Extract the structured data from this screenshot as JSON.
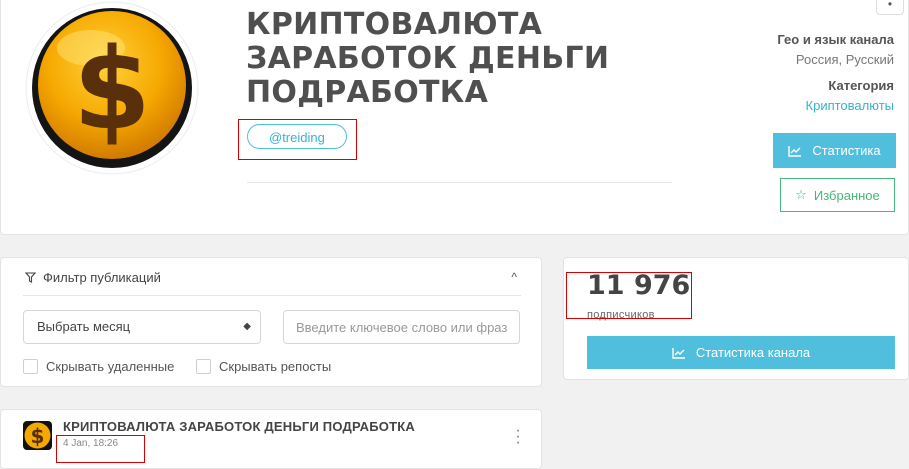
{
  "channel": {
    "title": "КРИПТОВАЛЮТА ЗАРАБОТОК ДЕНЬГИ ПОДРАБОТКА",
    "username": "@treiding",
    "avatar_icon": "gold-dollar-coin-icon"
  },
  "meta": {
    "geo_label": "Гео и язык канала",
    "geo_value": "Россия, Русский",
    "category_label": "Категория",
    "category_value": "Криптовалюты"
  },
  "buttons": {
    "statistics": "Статистика",
    "favorite": "Избранное",
    "channel_statistics": "Статистика канала"
  },
  "filter": {
    "title": "Фильтр публикаций",
    "month_select": "Выбрать месяц",
    "keyword_placeholder": "Введите ключевое слово или фразу",
    "hide_deleted": "Скрывать удаленные",
    "hide_reposts": "Скрывать репосты"
  },
  "subscribers": {
    "count": "11 976",
    "label": "подписчиков"
  },
  "post": {
    "title": "КРИПТОВАЛЮТА ЗАРАБОТОК ДЕНЬГИ ПОДРАБОТКА",
    "date": "4 Jan, 18:26"
  },
  "colors": {
    "accent": "#4fbfdd",
    "favorite": "#48b67d",
    "highlight": "#d90000"
  }
}
